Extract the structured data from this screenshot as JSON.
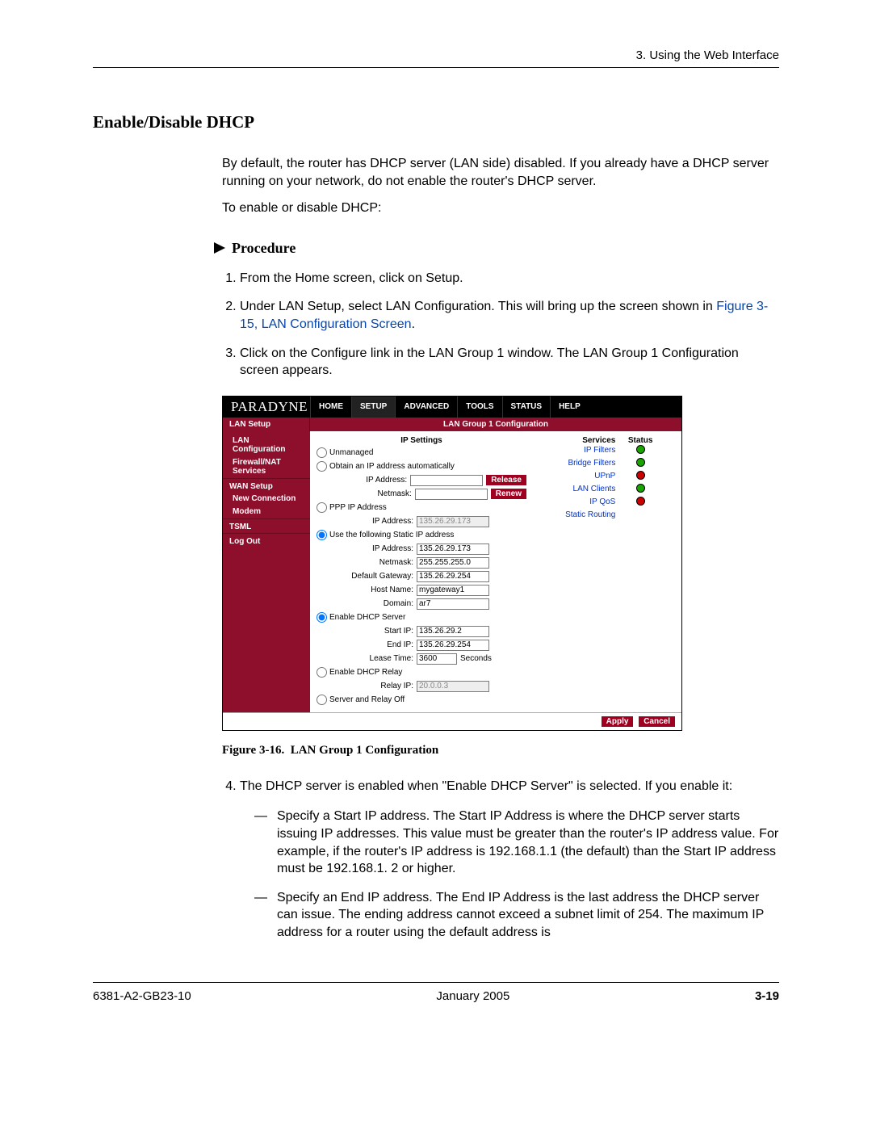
{
  "header": {
    "chapter": "3. Using the Web Interface"
  },
  "section": {
    "title": "Enable/Disable DHCP"
  },
  "intro": {
    "p1": "By default, the router has DHCP server (LAN side) disabled. If you already have a DHCP server running on your network, do not enable the router's DHCP server.",
    "p2": "To enable or disable DHCP:"
  },
  "procedure": {
    "label": "Procedure",
    "steps": {
      "s1": "From the Home screen, click on Setup.",
      "s2a": "Under LAN Setup, select LAN Configuration. This will bring up the screen shown in ",
      "s2link": "Figure 3-15, LAN Configuration Screen",
      "s2b": ".",
      "s3": "Click on the Configure link in the LAN Group 1 window. The LAN Group 1 Configuration screen appears.",
      "s4": "The DHCP server is enabled when \"Enable DHCP Server\" is selected. If you enable it:"
    },
    "substeps": {
      "a": "Specify a Start IP address. The Start IP Address is where the DHCP server starts issuing IP addresses. This value must be greater than the router's IP address value. For example, if the router's IP address is 192.168.1.1 (the default) than the Start IP address must be 192.168.1. 2 or higher.",
      "b": "Specify an End IP address. The End IP Address is the last address the DHCP server can issue. The ending address cannot exceed a subnet limit of 254. The maximum IP address for a router using the default address is"
    }
  },
  "figure": {
    "caption_no": "Figure 3-16.",
    "caption_text": "LAN Group 1 Configuration"
  },
  "router": {
    "brand": "PARADYNE",
    "nav": [
      "HOME",
      "SETUP",
      "ADVANCED",
      "TOOLS",
      "STATUS",
      "HELP"
    ],
    "subbar_left": "LAN Setup",
    "subbar_title": "LAN Group 1 Configuration",
    "sidebar": {
      "items": [
        {
          "label": "LAN Configuration",
          "indent": true
        },
        {
          "label": "Firewall/NAT Services",
          "indent": true
        },
        {
          "label": "WAN Setup",
          "head": true
        },
        {
          "label": "New Connection",
          "indent": true
        },
        {
          "label": "Modem",
          "indent": true
        },
        {
          "label": "TSML",
          "head": true
        },
        {
          "label": "Log Out",
          "head": true
        }
      ]
    },
    "settings": {
      "title": "IP Settings",
      "unmanaged": "Unmanaged",
      "obtain": "Obtain an IP address automatically",
      "ipaddr_lbl": "IP Address:",
      "netmask_lbl": "Netmask:",
      "release": "Release",
      "renew": "Renew",
      "ppp": "PPP IP Address",
      "ppp_ip_lbl": "IP Address:",
      "ppp_ip_val": "135.26.29.173",
      "use_static": "Use the following Static IP address",
      "static_ip_lbl": "IP Address:",
      "static_ip_val": "135.26.29.173",
      "static_nm_lbl": "Netmask:",
      "static_nm_val": "255.255.255.0",
      "gw_lbl": "Default Gateway:",
      "gw_val": "135.26.29.254",
      "host_lbl": "Host Name:",
      "host_val": "mygateway1",
      "domain_lbl": "Domain:",
      "domain_val": "ar7",
      "en_dhcp": "Enable DHCP Server",
      "start_lbl": "Start IP:",
      "start_val": "135.26.29.2",
      "end_lbl": "End IP:",
      "end_val": "135.26.29.254",
      "lease_lbl": "Lease Time:",
      "lease_val": "3600",
      "lease_suf": "Seconds",
      "en_relay": "Enable DHCP Relay",
      "relay_lbl": "Relay IP:",
      "relay_val": "20.0.0.3",
      "off": "Server and Relay Off"
    },
    "services": {
      "head1": "Services",
      "head2": "Status",
      "rows": [
        {
          "name": "IP Filters",
          "status": "g"
        },
        {
          "name": "Bridge Filters",
          "status": "g"
        },
        {
          "name": "UPnP",
          "status": "r"
        },
        {
          "name": "LAN Clients",
          "status": "g"
        },
        {
          "name": "IP QoS",
          "status": "r"
        },
        {
          "name": "Static Routing",
          "status": ""
        }
      ]
    },
    "buttons": {
      "apply": "Apply",
      "cancel": "Cancel"
    }
  },
  "footer": {
    "left": "6381-A2-GB23-10",
    "center": "January 2005",
    "right": "3-19"
  }
}
